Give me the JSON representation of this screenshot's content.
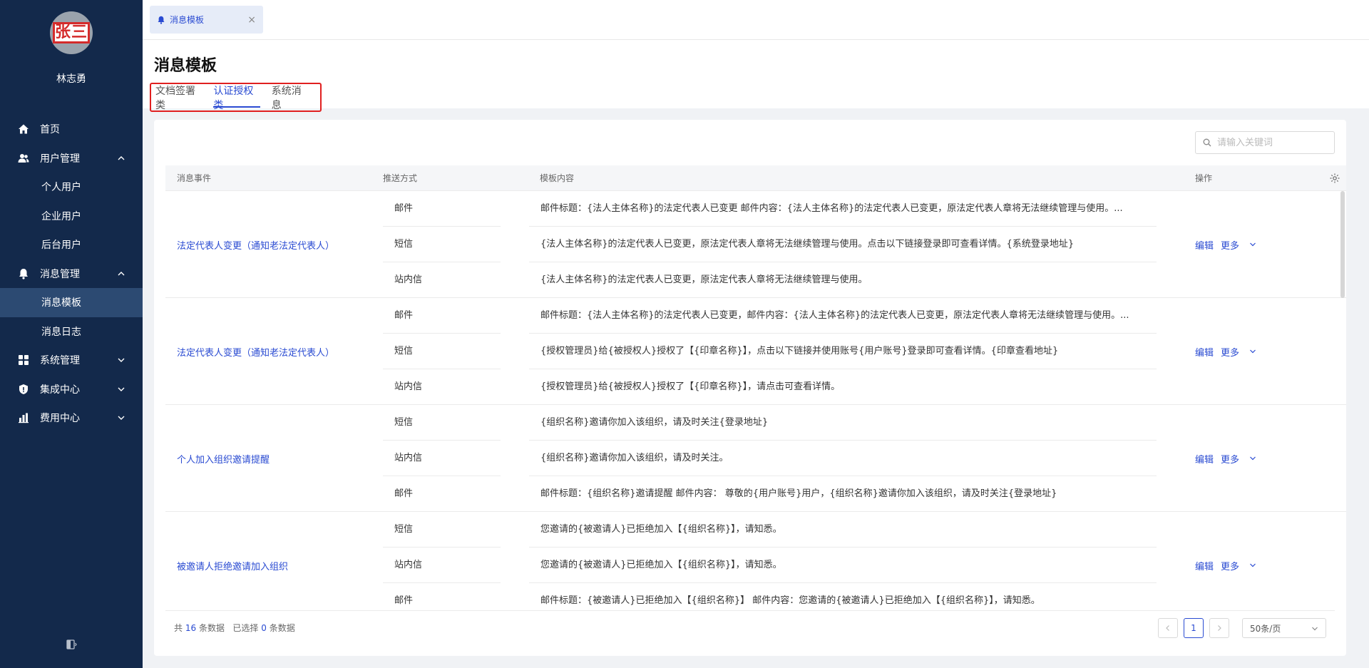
{
  "sidebar": {
    "avatar_text": "张三",
    "username": "林志勇",
    "items": [
      {
        "label": "首页",
        "icon": "home-icon"
      },
      {
        "label": "用户管理",
        "icon": "users-icon",
        "expanded": true
      },
      {
        "label": "个人用户"
      },
      {
        "label": "企业用户"
      },
      {
        "label": "后台用户"
      },
      {
        "label": "消息管理",
        "icon": "bell-icon",
        "expanded": true
      },
      {
        "label": "消息模板",
        "active": true
      },
      {
        "label": "消息日志"
      },
      {
        "label": "系统管理",
        "icon": "grid-icon",
        "expanded": false
      },
      {
        "label": "集成中心",
        "icon": "shield-icon",
        "expanded": false
      },
      {
        "label": "费用中心",
        "icon": "bar-chart-icon",
        "expanded": false
      }
    ]
  },
  "topbar": {
    "tab_label": "消息模板"
  },
  "page": {
    "title": "消息模板",
    "tabs": [
      "文档签署类",
      "认证授权类",
      "系统消息"
    ],
    "active_tab": "认证授权类"
  },
  "search": {
    "placeholder": "请输入关键词"
  },
  "table": {
    "headers": {
      "event": "消息事件",
      "method": "推送方式",
      "content": "模板内容",
      "ops": "操作"
    },
    "groups": [
      {
        "event": "法定代表人变更（通知老法定代表人）",
        "rows": [
          {
            "method": "邮件",
            "content": "邮件标题：{法人主体名称}的法定代表人已变更 邮件内容：{法人主体名称}的法定代表人已变更，原法定代表人章将无法继续管理与使用。..."
          },
          {
            "method": "短信",
            "content": "{法人主体名称}的法定代表人已变更，原法定代表人章将无法继续管理与使用。点击以下链接登录即可查看详情。{系统登录地址}"
          },
          {
            "method": "站内信",
            "content": "{法人主体名称}的法定代表人已变更，原法定代表人章将无法继续管理与使用。"
          }
        ]
      },
      {
        "event": "法定代表人变更（通知老法定代表人）",
        "rows": [
          {
            "method": "邮件",
            "content": "邮件标题：{法人主体名称}的法定代表人已变更，邮件内容：{法人主体名称}的法定代表人已变更，原法定代表人章将无法继续管理与使用。..."
          },
          {
            "method": "短信",
            "content": "{授权管理员}给{被授权人}授权了【{印章名称}】，点击以下链接并使用账号{用户账号}登录即可查看详情。{印章查看地址}"
          },
          {
            "method": "站内信",
            "content": "{授权管理员}给{被授权人}授权了【{印章名称}】，请点击可查看详情。"
          }
        ]
      },
      {
        "event": "个人加入组织邀请提醒",
        "rows": [
          {
            "method": "短信",
            "content": "{组织名称}邀请你加入该组织，请及时关注{登录地址}"
          },
          {
            "method": "站内信",
            "content": "{组织名称}邀请你加入该组织，请及时关注。"
          },
          {
            "method": "邮件",
            "content": "邮件标题：{组织名称}邀请提醒 邮件内容： 尊敬的{用户账号}用户，{组织名称}邀请你加入该组织，请及时关注{登录地址}"
          }
        ]
      },
      {
        "event": "被邀请人拒绝邀请加入组织",
        "rows": [
          {
            "method": "短信",
            "content": "您邀请的{被邀请人}已拒绝加入【{组织名称}】，请知悉。"
          },
          {
            "method": "站内信",
            "content": "您邀请的{被邀请人}已拒绝加入【{组织名称}】，请知悉。"
          },
          {
            "method": "邮件",
            "content": "邮件标题：{被邀请人}已拒绝加入【{组织名称}】 邮件内容：您邀请的{被邀请人}已拒绝加入【{组织名称}】，请知悉。"
          }
        ]
      }
    ],
    "op_edit": "编辑",
    "op_more": "更多"
  },
  "footer": {
    "total_prefix": "共",
    "total_count": "16",
    "total_suffix": "条数据",
    "selected_prefix": "已选择",
    "selected_count": "0",
    "selected_suffix": "条数据",
    "current_page": "1",
    "page_size": "50条/页"
  },
  "colors": {
    "sidebar_bg": "#13294b",
    "accent": "#2a4bd2",
    "highlight_border": "#e02020"
  }
}
